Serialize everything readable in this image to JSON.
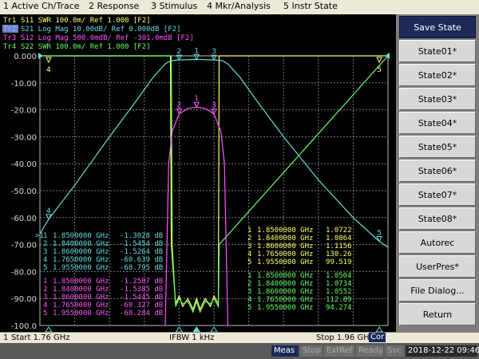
{
  "menu": [
    "1 Active Ch/Trace",
    "2 Response",
    "3 Stimulus",
    "4 Mkr/Analysis",
    "5 Instr State"
  ],
  "traces": [
    {
      "label": "Tr1",
      "text": "S11 SWR 100.0m/ Ref 1.000 [F2]",
      "color": "#ffff66"
    },
    {
      "label": "Tr2",
      "text": "S21 Log Mag 10.00dB/ Ref 0.000dB [F2]",
      "color": "#66dddd",
      "active": true
    },
    {
      "label": "Tr3",
      "text": "S12 Log Mag 500.0mdB/ Ref -301.0mdB [F2]",
      "color": "#ff55ff"
    },
    {
      "label": "Tr4",
      "text": "S22 SWR 100.0m/ Ref 1.000 [F2]",
      "color": "#66ff66"
    }
  ],
  "y_axis_labels": [
    "0.000",
    "-10.00",
    "-20.00",
    "-30.00",
    "-40.00",
    "-50.00",
    "-60.00",
    "-70.00",
    "-80.00",
    "-90.00",
    "-100.0"
  ],
  "active_marker_prefix": ">1",
  "marker_table_s21": [
    {
      "n": "1",
      "freq": "1.8500000 GHz",
      "val": "-1.3028 dB"
    },
    {
      "n": "2",
      "freq": "1.8400000 GHz",
      "val": "-1.5454 dB"
    },
    {
      "n": "3",
      "freq": "1.8600000 GHz",
      "val": "-1.5264 dB"
    },
    {
      "n": "4",
      "freq": "1.7650000 GHz",
      "val": "-60.639 dB"
    },
    {
      "n": "5",
      "freq": "1.9550000 GHz",
      "val": "-68.795 dB"
    }
  ],
  "marker_table_s12": [
    {
      "n": "1",
      "freq": "1.8500000 GHz",
      "val": "-1.2507 dB"
    },
    {
      "n": "2",
      "freq": "1.8400000 GHz",
      "val": "-1.5385 dB"
    },
    {
      "n": "3",
      "freq": "1.8600000 GHz",
      "val": "-1.5445 dB"
    },
    {
      "n": "4",
      "freq": "1.7650000 GHz",
      "val": "-60.327 dB"
    },
    {
      "n": "5",
      "freq": "1.9550000 GHz",
      "val": "-68.284 dB"
    }
  ],
  "marker_table_s11": [
    {
      "n": "1",
      "freq": "1.8500000 GHz",
      "val": "1.0722"
    },
    {
      "n": "2",
      "freq": "1.8400000 GHz",
      "val": "1.0864"
    },
    {
      "n": "3",
      "freq": "1.8600000 GHz",
      "val": "1.1156"
    },
    {
      "n": "4",
      "freq": "1.7650000 GHz",
      "val": "130.26"
    },
    {
      "n": "5",
      "freq": "1.9550000 GHz",
      "val": "99.519"
    }
  ],
  "marker_table_s22": [
    {
      "n": "1",
      "freq": "1.8500000 GHz",
      "val": "1.0504"
    },
    {
      "n": "2",
      "freq": "1.8400000 GHz",
      "val": "1.0734"
    },
    {
      "n": "3",
      "freq": "1.8600000 GHz",
      "val": "1.0552"
    },
    {
      "n": "4",
      "freq": "1.7650000 GHz",
      "val": "112.89"
    },
    {
      "n": "5",
      "freq": "1.9550000 GHz",
      "val": "94.274"
    }
  ],
  "softkeys": [
    "Save State",
    "State01*",
    "State02*",
    "State03*",
    "State04*",
    "State05*",
    "State06*",
    "State07*",
    "State08*",
    "Autorec",
    "UserPres*",
    "File Dialog...",
    "Return"
  ],
  "bottom": {
    "channel": "1",
    "start": "Start 1.76 GHz",
    "ifbw": "IFBW 1 kHz",
    "stop": "Stop 1.96 GHz",
    "cor": "Cor"
  },
  "status": {
    "meas": "Meas",
    "stop": "Stop",
    "extref": "ExtRef",
    "ready": "Ready",
    "svc": "Svc",
    "datetime": "2018-12-22 09:46"
  },
  "chart_data": {
    "type": "line",
    "x_range_ghz": [
      1.76,
      1.96
    ],
    "y_range_db": [
      -100,
      0
    ],
    "ylim": [
      -100,
      0
    ],
    "series": [
      {
        "name": "S21",
        "x": [
          1.76,
          1.765,
          1.78,
          1.8,
          1.815,
          1.825,
          1.832,
          1.835,
          1.84,
          1.85,
          1.86,
          1.865,
          1.868,
          1.875,
          1.885,
          1.9,
          1.92,
          1.94,
          1.955,
          1.96
        ],
        "y": [
          -66,
          -60.6,
          -48,
          -30,
          -17,
          -8,
          -3,
          -1.8,
          -1.5,
          -1.3,
          -1.5,
          -1.8,
          -3,
          -8,
          -17,
          -30,
          -46,
          -60,
          -68.8,
          -71
        ]
      },
      {
        "name": "S12",
        "x": [
          1.832,
          1.834,
          1.836,
          1.84,
          1.845,
          1.85,
          1.855,
          1.86,
          1.864,
          1.866,
          1.868
        ],
        "y": [
          -100,
          -40,
          -28,
          -21.5,
          -19.5,
          -19,
          -19.5,
          -21.5,
          -28,
          -40,
          -100
        ]
      },
      {
        "name": "S11",
        "x": [
          1.76,
          1.835,
          1.8355,
          1.838,
          1.84,
          1.842,
          1.845,
          1.848,
          1.85,
          1.852,
          1.855,
          1.858,
          1.86,
          1.8625,
          1.863,
          1.96
        ],
        "y": [
          0,
          0,
          -70,
          -92,
          -89,
          -93,
          -90,
          -94,
          -90,
          -94,
          -90,
          -93,
          -89,
          -92,
          0,
          0
        ]
      },
      {
        "name": "S22",
        "x": [
          1.76,
          1.8355,
          1.836,
          1.838,
          1.84,
          1.842,
          1.845,
          1.848,
          1.85,
          1.852,
          1.855,
          1.858,
          1.86,
          1.8625,
          1.863,
          1.96
        ],
        "y": [
          0,
          0,
          -70,
          -93,
          -90,
          -92,
          -91,
          -95,
          -91,
          -95,
          -91,
          -92,
          -90,
          -93,
          -70,
          0
        ]
      }
    ],
    "markers": [
      {
        "n": "1",
        "x": 1.85
      },
      {
        "n": "2",
        "x": 1.84
      },
      {
        "n": "3",
        "x": 1.86
      },
      {
        "n": "4",
        "x": 1.765
      },
      {
        "n": "5",
        "x": 1.955
      }
    ]
  }
}
